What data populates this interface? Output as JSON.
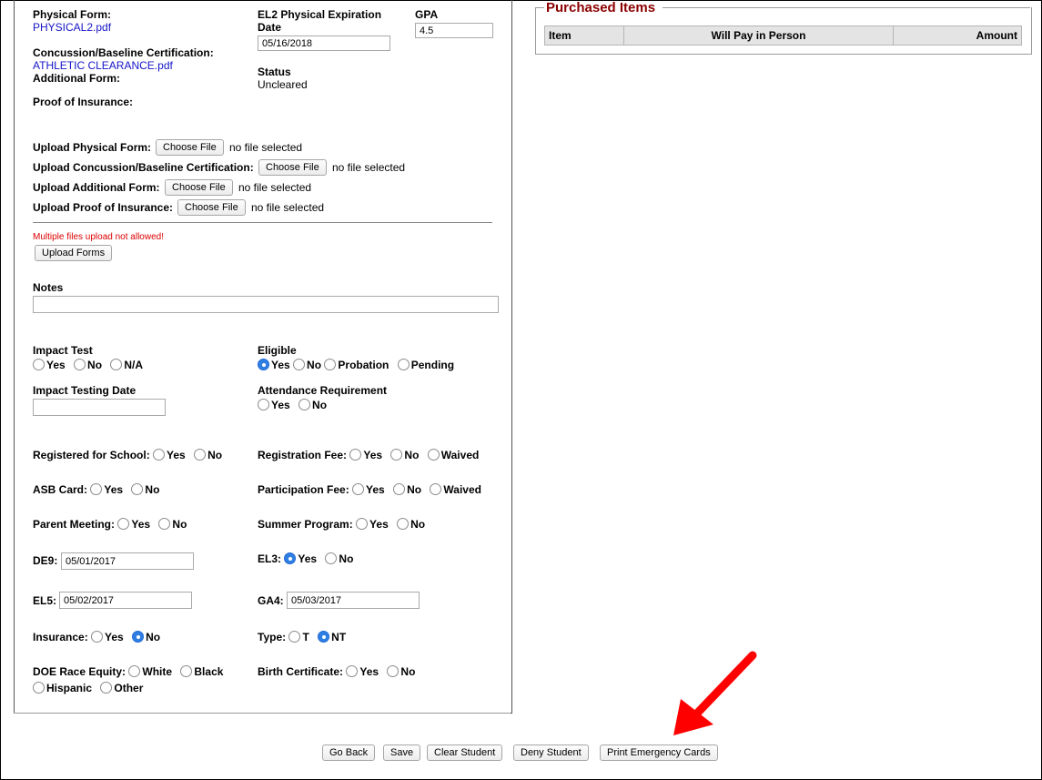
{
  "left": {
    "physical_form_label": "Physical Form:",
    "physical_form_file": "PHYSICAL2.pdf",
    "concussion_label": "Concussion/Baseline Certification:",
    "concussion_file": "ATHLETIC CLEARANCE.pdf",
    "additional_form_label": "Additional Form:",
    "proof_insurance_label": "Proof of Insurance:",
    "el2_label_line1": "EL2 Physical Expiration",
    "el2_label_line2": "Date",
    "el2_value": "05/16/2018",
    "gpa_label": "GPA",
    "gpa_value": "4.5",
    "status_label": "Status",
    "status_value": "Uncleared"
  },
  "uploads": [
    {
      "label": "Upload Physical Form:",
      "button": "Choose File",
      "status": "no file selected"
    },
    {
      "label": "Upload Concussion/Baseline Certification:",
      "button": "Choose File",
      "status": "no file selected"
    },
    {
      "label": "Upload Additional Form:",
      "button": "Choose File",
      "status": "no file selected"
    },
    {
      "label": "Upload Proof of Insurance:",
      "button": "Choose File",
      "status": "no file selected"
    }
  ],
  "upload_warning": "Multiple files upload not allowed!",
  "upload_button": "Upload Forms",
  "notes_label": "Notes",
  "notes_value": "",
  "impact_test": {
    "label": "Impact Test",
    "options": [
      "Yes",
      "No",
      "N/A"
    ]
  },
  "eligible": {
    "label": "Eligible",
    "options": [
      "Yes",
      "No",
      "Probation",
      "Pending"
    ],
    "selected": "Yes"
  },
  "impact_date": {
    "label": "Impact Testing Date",
    "value": ""
  },
  "attendance": {
    "label": "Attendance Requirement",
    "options": [
      "Yes",
      "No"
    ]
  },
  "registered": {
    "label": "Registered for School:",
    "options": [
      "Yes",
      "No"
    ]
  },
  "reg_fee": {
    "label": "Registration Fee:",
    "options": [
      "Yes",
      "No",
      "Waived"
    ]
  },
  "asb": {
    "label": "ASB Card:",
    "options": [
      "Yes",
      "No"
    ]
  },
  "part_fee": {
    "label": "Participation Fee:",
    "options": [
      "Yes",
      "No",
      "Waived"
    ]
  },
  "parent_meeting": {
    "label": "Parent Meeting:",
    "options": [
      "Yes",
      "No"
    ]
  },
  "summer": {
    "label": "Summer Program:",
    "options": [
      "Yes",
      "No"
    ]
  },
  "de9": {
    "label": "DE9:",
    "value": "05/01/2017"
  },
  "el3": {
    "label": "EL3:",
    "options": [
      "Yes",
      "No"
    ],
    "selected": "Yes"
  },
  "el5": {
    "label": "EL5:",
    "value": "05/02/2017"
  },
  "ga4": {
    "label": "GA4:",
    "value": "05/03/2017"
  },
  "insurance": {
    "label": "Insurance:",
    "options": [
      "Yes",
      "No"
    ],
    "selected": "No"
  },
  "type": {
    "label": "Type:",
    "options": [
      "T",
      "NT"
    ],
    "selected": "NT"
  },
  "race": {
    "label": "DOE Race Equity:",
    "options": [
      "White",
      "Black",
      "Hispanic",
      "Other"
    ]
  },
  "birth_cert": {
    "label": "Birth Certificate:",
    "options": [
      "Yes",
      "No"
    ]
  },
  "purchased": {
    "legend": "Purchased Items",
    "columns": [
      "Item",
      "Will Pay in Person",
      "Amount"
    ]
  },
  "footer_buttons": [
    "Go Back",
    "Save",
    "Clear Student",
    "Deny Student",
    "Print Emergency Cards"
  ],
  "colors": {
    "legend": "#8b0000",
    "link": "#1515c8",
    "warning": "#dd0000",
    "annotation_arrow": "#ff0000",
    "radio_selected": "#2f7fe3"
  }
}
